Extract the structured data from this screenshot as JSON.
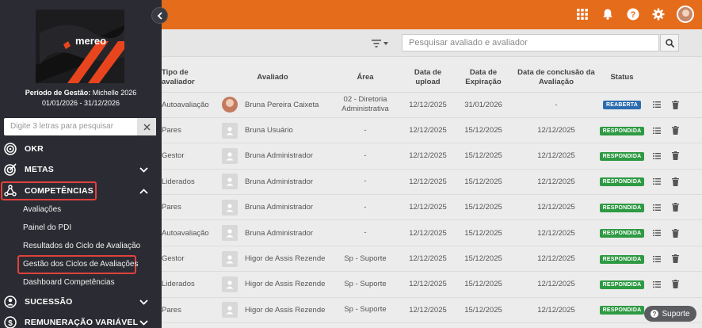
{
  "colors": {
    "brand": "#e56c1a",
    "sidebar": "#2b2c33",
    "badge_reaberta": "#2b6cb0",
    "badge_respondida": "#2e9a43",
    "highlight": "#e0413d"
  },
  "logo": {
    "text": "mereo"
  },
  "sidebar": {
    "period_label": "Período de Gestão:",
    "period_name": "Michelle 2026",
    "period_range": "01/01/2026 - 31/12/2026",
    "search_placeholder": "Digite 3 letras para pesquisar",
    "menu": {
      "okr": "OKR",
      "metas": "METAS",
      "competencias": "COMPETÊNCIAS",
      "sucessao": "SUCESSÃO",
      "remuneracao": "REMUNERAÇÃO VARIÁVEL"
    },
    "sub": {
      "avaliacoes": "Avaliações",
      "pdi": "Painel do PDI",
      "resultados": "Resultados do Ciclo de Avaliação",
      "gestao": "Gestão dos Ciclos de Avaliações",
      "dashboard": "Dashboard Competências"
    }
  },
  "toolbar": {
    "search_placeholder": "Pesquisar avaliado e avaliador"
  },
  "table": {
    "headers": [
      "Tipo de avaliador",
      "Avaliado",
      "Área",
      "Data de upload",
      "Data de Expiração",
      "Data de conclusão da Avaliação",
      "Status"
    ],
    "rows": [
      [
        "Autoavaliação",
        "Bruna Pereira Caixeta",
        "02 - Diretoria Administrativa",
        "12/12/2025",
        "31/01/2026",
        "-",
        "REABERTA"
      ],
      [
        "Pares",
        "Bruna Usuário",
        "-",
        "12/12/2025",
        "15/12/2025",
        "12/12/2025",
        "RESPONDIDA"
      ],
      [
        "Gestor",
        "Bruna Administrador",
        "-",
        "12/12/2025",
        "15/12/2025",
        "12/12/2025",
        "RESPONDIDA"
      ],
      [
        "Liderados",
        "Bruna Administrador",
        "-",
        "12/12/2025",
        "15/12/2025",
        "12/12/2025",
        "RESPONDIDA"
      ],
      [
        "Pares",
        "Bruna Administrador",
        "-",
        "12/12/2025",
        "15/12/2025",
        "12/12/2025",
        "RESPONDIDA"
      ],
      [
        "Autoavaliação",
        "Bruna Administrador",
        "-",
        "12/12/2025",
        "15/12/2025",
        "12/12/2025",
        "RESPONDIDA"
      ],
      [
        "Gestor",
        "Higor de Assis Rezende",
        "Sp - Suporte",
        "12/12/2025",
        "15/12/2025",
        "12/12/2025",
        "RESPONDIDA"
      ],
      [
        "Liderados",
        "Higor de Assis Rezende",
        "Sp - Suporte",
        "12/12/2025",
        "15/12/2025",
        "12/12/2025",
        "RESPONDIDA"
      ],
      [
        "Pares",
        "Higor de Assis Rezende",
        "Sp - Suporte",
        "12/12/2025",
        "15/12/2025",
        "12/12/2025",
        "RESPONDIDA"
      ]
    ]
  },
  "support": {
    "label": "Suporte"
  }
}
